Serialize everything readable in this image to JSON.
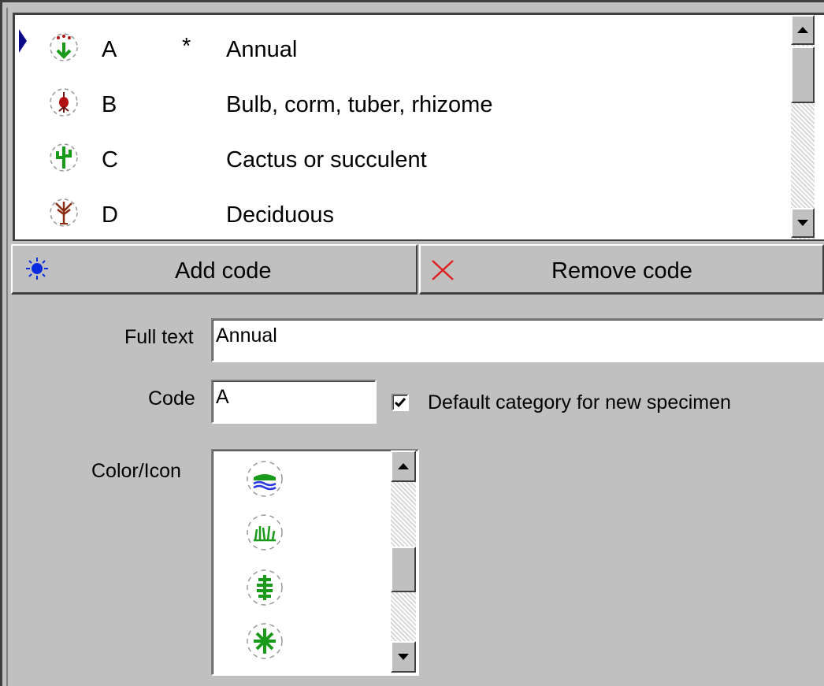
{
  "categories": {
    "rows": [
      {
        "code": "A",
        "default_mark": "*",
        "text": "Annual",
        "icon": "annual-plant-icon",
        "selected": true
      },
      {
        "code": "B",
        "default_mark": "",
        "text": "Bulb, corm, tuber, rhizome",
        "icon": "bulb-icon",
        "selected": false
      },
      {
        "code": "C",
        "default_mark": "",
        "text": "Cactus or succulent",
        "icon": "cactus-icon",
        "selected": false
      },
      {
        "code": "D",
        "default_mark": "",
        "text": "Deciduous",
        "icon": "deciduous-tree-icon",
        "selected": false
      }
    ]
  },
  "toolbar": {
    "add_label": "Add code",
    "add_icon": "sun-icon",
    "remove_label": "Remove code",
    "remove_icon": "red-x-icon"
  },
  "form": {
    "full_text_label": "Full text",
    "full_text_value": "Annual",
    "code_label": "Code",
    "code_value": "A",
    "default_checkbox_label": "Default category for new specimen",
    "default_checked": true,
    "color_icon_label": "Color/Icon",
    "icon_options": [
      "water-plant-icon",
      "grass-icon",
      "fern-icon",
      "star-plant-icon"
    ]
  },
  "colors": {
    "window_bg": "#c0c0c0",
    "selection_indicator": "#0a0a8a",
    "icon_green": "#1a9a1a",
    "icon_red": "#b01010"
  }
}
